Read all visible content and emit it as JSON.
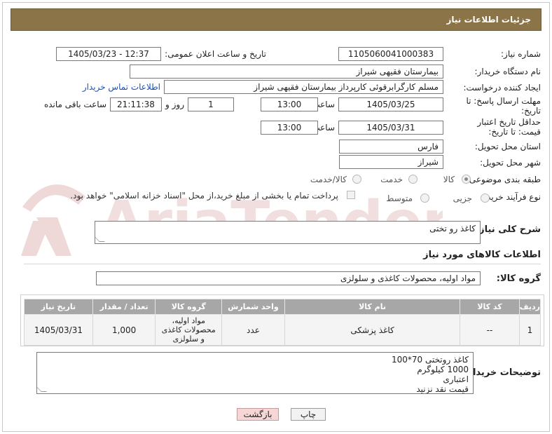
{
  "header": {
    "title": "جزئیات اطلاعات نیاز"
  },
  "form": {
    "need_number_label": "شماره نیاز:",
    "need_number": "1105060041000383",
    "announce_label": "تاریخ و ساعت اعلان عمومی:",
    "announce_value": "1405/03/23 - 12:37",
    "buyer_org_label": "نام دستگاه خریدار:",
    "buyer_org": "بیمارستان فقیهی شیراز",
    "creator_label": "ایجاد کننده درخواست:",
    "creator": "مسلم کارگرابرقوئی کارپرداز  بیمارستان فقیهی شیراز",
    "contact_link": "اطلاعات تماس خریدار",
    "deadline_label": "مهلت ارسال پاسخ: تا تاریخ:",
    "deadline_date": "1405/03/25",
    "time_label": "ساعت",
    "deadline_time": "13:00",
    "days_value": "1",
    "days_label": "روز و",
    "remaining_time": "21:11:38",
    "remaining_label": "ساعت باقی مانده",
    "price_validity_label": "حداقل تاریخ اعتبار قیمت: تا تاریخ:",
    "price_validity_date": "1405/03/31",
    "price_validity_time": "13:00",
    "province_label": "استان محل تحویل:",
    "province": "فارس",
    "city_label": "شهر محل تحویل:",
    "city": "شیراز",
    "category_label": "طبقه بندی موضوعی:",
    "category_options": [
      "کالا",
      "خدمت",
      "کالا/خدمت"
    ],
    "process_label": "نوع فرآیند خرید :",
    "process_options": [
      "جزیی",
      "متوسط"
    ],
    "payment_note": "پرداخت تمام یا بخشی از مبلغ خرید،از محل \"اسناد خزانه اسلامی\" خواهد بود.",
    "description_label": "شرح کلی نیاز:",
    "description": "کاغذ رو تختی",
    "goods_info_title": "اطلاعات کالاهای مورد نیاز",
    "goods_group_label": "گروه کالا:",
    "goods_group": "مواد اولیه، محصولات کاغذی و سلولزی"
  },
  "table": {
    "headers": [
      "ردیف",
      "کد کالا",
      "نام کالا",
      "واحد شمارش",
      "گروه کالا",
      "تعداد / مقدار",
      "تاریخ نیاز"
    ],
    "rows": [
      [
        "1",
        "--",
        "کاغذ پزشکی",
        "عدد",
        "مواد اولیه، محصولات کاغذی و سلولزی",
        "1,000",
        "1405/03/31"
      ]
    ]
  },
  "buyer_notes": {
    "label": "توضیحات خریدار:",
    "lines": [
      "کاغذ روتختی 70*100",
      "1000 کیلوگرم",
      "اعتباری",
      "قیمت نقد نزنید"
    ]
  },
  "buttons": {
    "back": "بازگشت",
    "print": "چاپ"
  },
  "watermark": {
    "text": "AriaTender.neT",
    "color": "#e8c9c9"
  }
}
